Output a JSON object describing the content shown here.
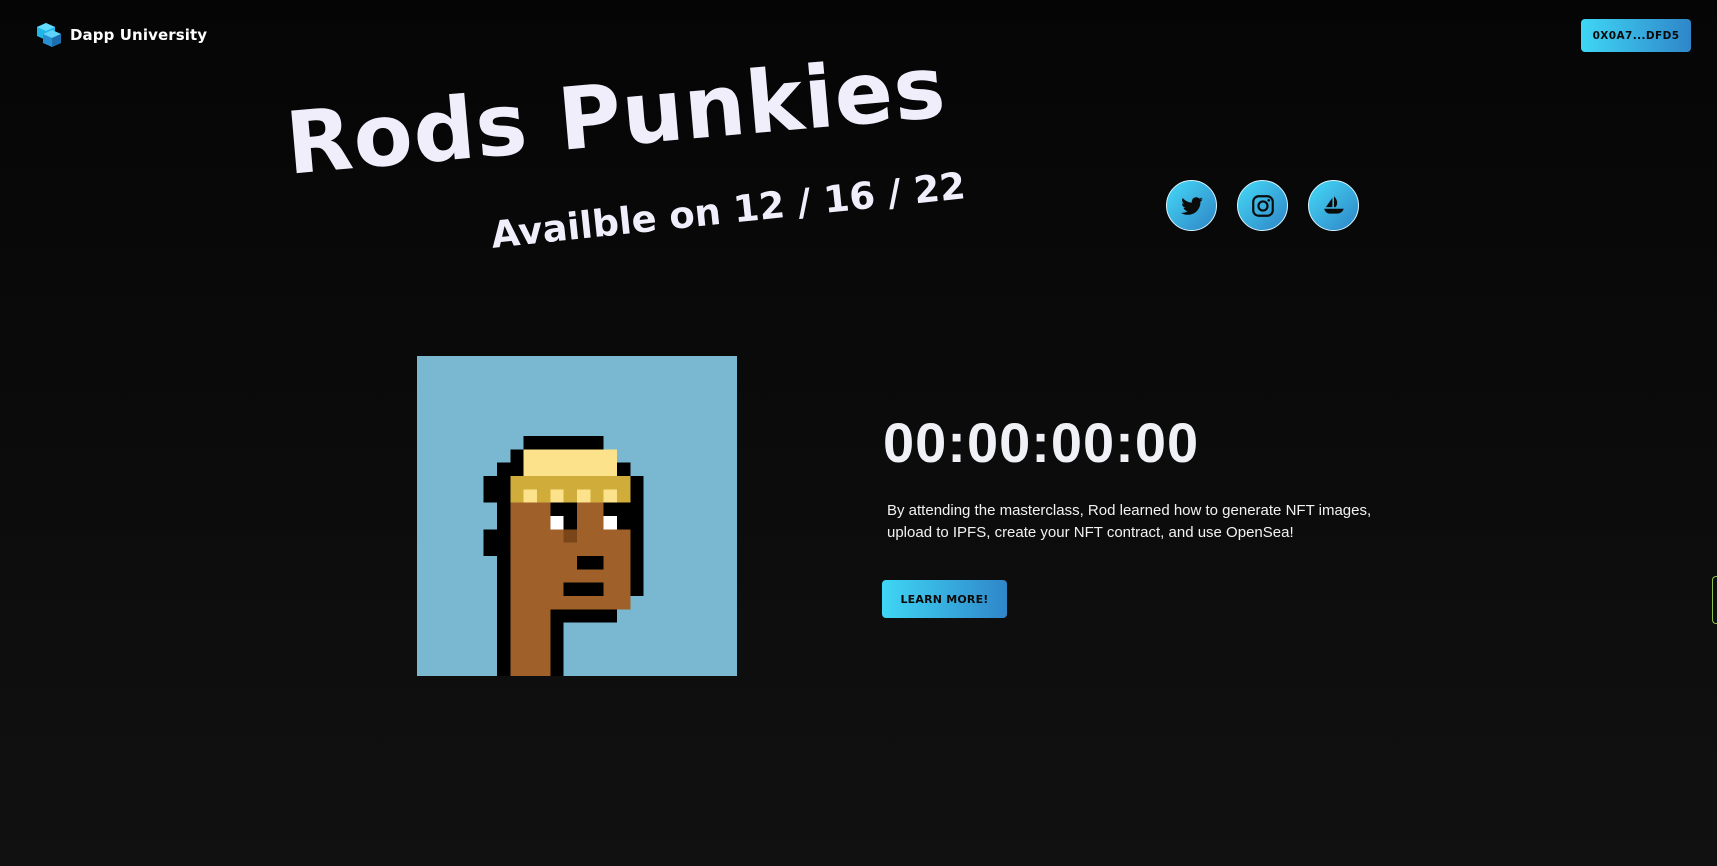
{
  "navbar": {
    "brand_name": "Dapp University",
    "wallet_label": "0X0A7...DFD5"
  },
  "hero": {
    "title": "Rods Punkies",
    "subtitle": "Availble on 12 / 16 / 22"
  },
  "socials": [
    {
      "icon": "twitter-icon"
    },
    {
      "icon": "instagram-icon"
    },
    {
      "icon": "opensea-icon"
    }
  ],
  "countdown": {
    "value": "00:00:00:00"
  },
  "info": {
    "description": "By attending the masterclass, Rod learned how to generate NFT images, upload to IPFS, create your NFT contract, and use OpenSea!",
    "button_label": "LEARN MORE!"
  },
  "colors": {
    "accent_start": "#3fd6f5",
    "accent_end": "#2f86c9",
    "nft_background": "#79b8d0",
    "skin": "#a0602a",
    "beanie": "#fce28a"
  }
}
